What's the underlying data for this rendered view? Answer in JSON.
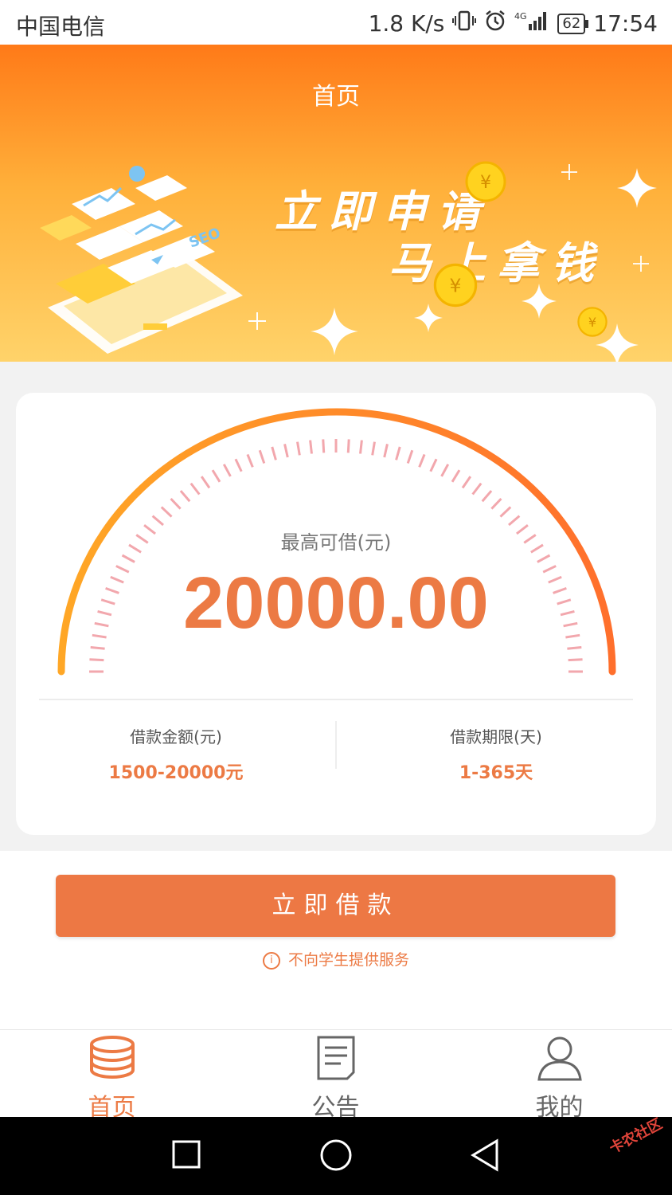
{
  "status_bar": {
    "carrier": "中国电信",
    "net_speed": "1.8 K/s",
    "network": "4G",
    "battery": "62",
    "time": "17:54"
  },
  "banner": {
    "title": "首页",
    "slogan_line1": "立即申请",
    "slogan_line2": "马上拿钱",
    "illustration_text": "SEO"
  },
  "gauge": {
    "label": "最高可借(元)",
    "value": "20000.00",
    "arc_colors": [
      "#ffa726",
      "#ff6f2c"
    ]
  },
  "info": {
    "amount_label": "借款金额(元)",
    "amount_value": "1500-20000元",
    "term_label": "借款期限(天)",
    "term_value": "1-365天"
  },
  "cta": {
    "button_label": "立即借款",
    "notice": "不向学生提供服务"
  },
  "tabs": [
    {
      "label": "首页",
      "icon": "coins-stack-icon",
      "active": true
    },
    {
      "label": "公告",
      "icon": "document-icon",
      "active": false
    },
    {
      "label": "我的",
      "icon": "person-icon",
      "active": false
    }
  ],
  "colors": {
    "accent": "#ec7a44",
    "banner_top": "#ff7a18",
    "banner_bottom": "#ffd36a"
  },
  "watermark": "卡农社区"
}
